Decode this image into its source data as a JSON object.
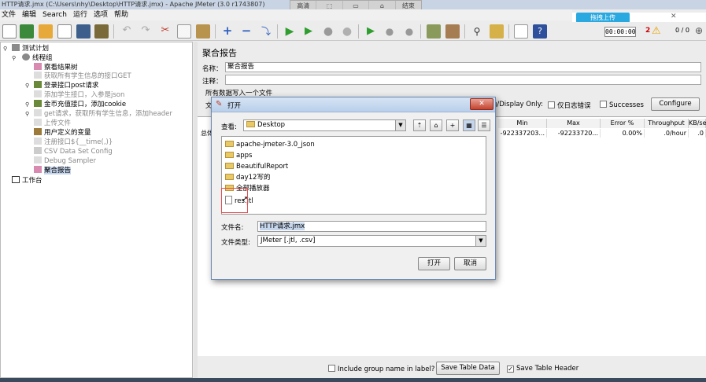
{
  "window": {
    "title": "HTTP请求.jmx (C:\\Users\\nhy\\Desktop\\HTTP请求.jmx) - Apache JMeter (3.0 r1743807)"
  },
  "recorder_bar": [
    "高清",
    "",
    "",
    "",
    "结束"
  ],
  "upload": {
    "label": "拖拽上传",
    "close": "✕"
  },
  "menu": [
    "文件",
    "编辑",
    "Search",
    "运行",
    "选项",
    "帮助"
  ],
  "status": {
    "timer": "00:00:00",
    "errors": "2",
    "threads": "0 / 0"
  },
  "tree": {
    "items": [
      {
        "label": "测试计划"
      },
      {
        "label": "线程组"
      },
      {
        "label": "察看结果树"
      },
      {
        "label": "获取所有学生信息的接口GET"
      },
      {
        "label": "登录接口post请求"
      },
      {
        "label": "添加学生接口，入参是json"
      },
      {
        "label": "金币充值接口，添加cookie"
      },
      {
        "label": "get请求，获取所有学生信息，添加header"
      },
      {
        "label": "上传文件"
      },
      {
        "label": "用户定义的变量"
      },
      {
        "label": "注册接口${__time(,)}"
      },
      {
        "label": "CSV Data Set Config"
      },
      {
        "label": "Debug Sampler"
      },
      {
        "label": "聚合报告"
      },
      {
        "label": "工作台"
      }
    ]
  },
  "report": {
    "heading": "聚合报告",
    "name_label": "名称：",
    "name_value": "聚合报告",
    "comment_label": "注释：",
    "comment_value": "",
    "file_section": "所有数据写入一个文件",
    "file_label": "文",
    "log_display_text": "g/Display Only:",
    "errors_label": "仅日志错误",
    "successes_label": "Successes",
    "configure_label": "Configure"
  },
  "table": {
    "columns": [
      "Min",
      "Max",
      "Error %",
      "Throughput",
      "KB/sec"
    ],
    "row_label": "总体",
    "row": [
      "-922337203...",
      "-92233720...",
      "0.00%",
      ".0/hour",
      ".0"
    ]
  },
  "bottom": {
    "group_label": "Include group name in label?",
    "save_label": "Save Table Data",
    "header_label": "Save Table Header"
  },
  "dialog": {
    "title": "打开",
    "close": "✕",
    "lookin_label": "查看:",
    "lookin_value": "Desktop",
    "files": [
      {
        "name": "apache-jmeter-3.0_json",
        "type": "folder"
      },
      {
        "name": "apps",
        "type": "folder"
      },
      {
        "name": "BeautifulReport",
        "type": "folder"
      },
      {
        "name": "day12写的",
        "type": "folder"
      },
      {
        "name": "全部播放器",
        "type": "folder"
      },
      {
        "name": "res.jtl",
        "type": "file"
      }
    ],
    "filename_label": "文件名:",
    "filename_value": "HTTP请求.jmx",
    "filetype_label": "文件类型:",
    "filetype_value": "JMeter [.jtl, .csv]",
    "open_label": "打开",
    "cancel_label": "取消"
  },
  "colors": {
    "accent": "#2aa9e0",
    "selection": "#c5d5ec",
    "error": "#cc0000"
  }
}
